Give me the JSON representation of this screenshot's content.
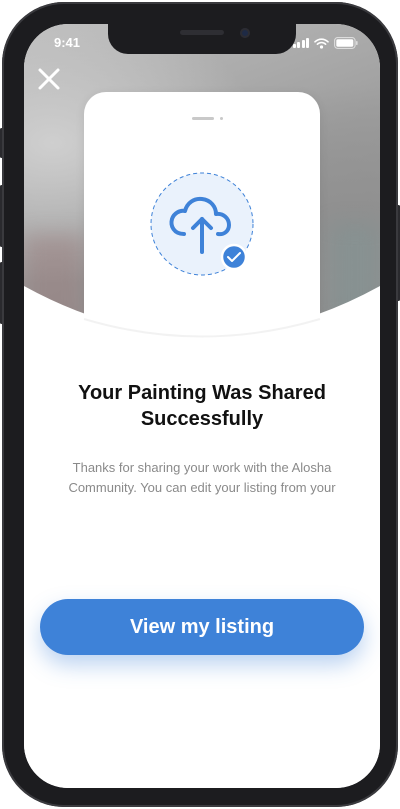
{
  "status_bar": {
    "time": "9:41"
  },
  "icons": {
    "close": "close-icon",
    "upload": "cloud-upload-icon",
    "check": "check-badge-icon",
    "signal": "signal-icon",
    "wifi": "wifi-icon",
    "battery": "battery-icon"
  },
  "content": {
    "title_line1": "Your Painting Was Shared",
    "title_line2": "Successfully",
    "description_line1": "Thanks for sharing your work with the Alosha",
    "description_line2": "Community. You can edit your listing from your"
  },
  "cta": {
    "label": "View my listing"
  },
  "colors": {
    "accent": "#3e82d8",
    "title_text": "#111111",
    "body_text": "#8a8a8a",
    "icon_fill": "#eaf2fc"
  }
}
